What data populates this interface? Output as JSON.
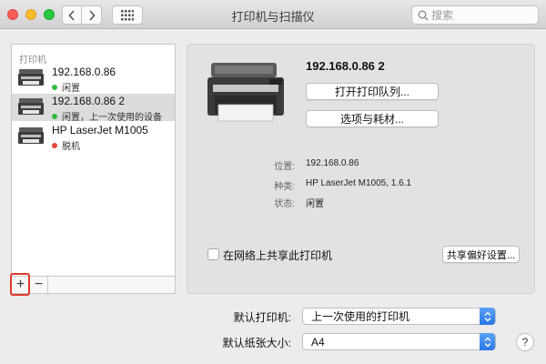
{
  "window": {
    "title": "打印机与扫描仪",
    "search_placeholder": "搜索"
  },
  "icons": {
    "back": "chevron-left-icon",
    "forward": "chevron-right-icon",
    "grid": "grid-icon",
    "search": "search-icon",
    "printer": "printer-icon",
    "help": "help-icon"
  },
  "colors": {
    "status_idle": "#2fba3f",
    "status_offline": "#e5453c",
    "highlight_box": "#e0382d",
    "select_accent": "#2a78e6"
  },
  "sidebar": {
    "header": "打印机",
    "items": [
      {
        "name": "192.168.0.86",
        "status": "闲置",
        "status_color": "#2fba3f",
        "selected": false
      },
      {
        "name": "192.168.0.86 2",
        "status": "闲置，上一次使用的设备",
        "status_color": "#2fba3f",
        "selected": true
      },
      {
        "name": "HP LaserJet M1005",
        "status": "脱机",
        "status_color": "#e5453c",
        "selected": false
      }
    ],
    "add_label": "+",
    "remove_label": "−"
  },
  "detail": {
    "printer_name": "192.168.0.86 2",
    "open_queue_label": "打开打印队列...",
    "options_supplies_label": "选项与耗材...",
    "location_label": "位置:",
    "location_value": "192.168.0.86",
    "kind_label": "种类:",
    "kind_value": "HP LaserJet M1005, 1.6.1",
    "status_label": "状态:",
    "status_value": "闲置",
    "share_checkbox_label": "在网络上共享此打印机",
    "share_checked": false,
    "share_prefs_label": "共享偏好设置..."
  },
  "defaults": {
    "default_printer_label": "默认打印机:",
    "default_printer_value": "上一次使用的打印机",
    "default_paper_label": "默认纸张大小:",
    "default_paper_value": "A4"
  },
  "help_label": "?"
}
